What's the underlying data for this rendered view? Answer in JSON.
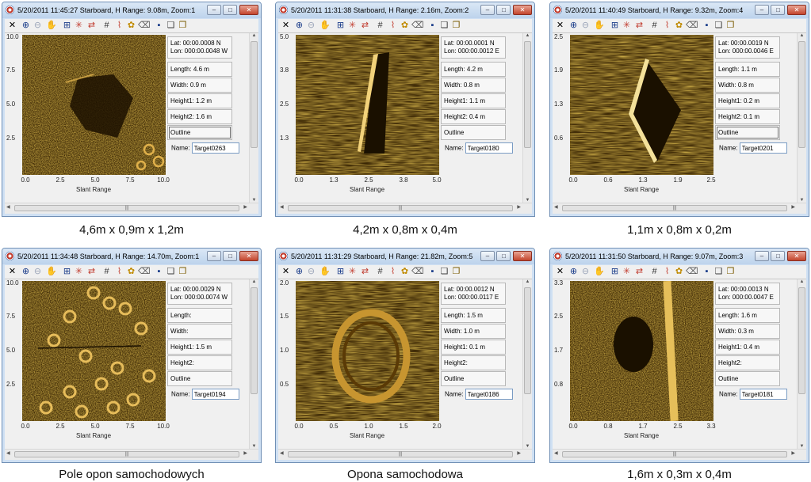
{
  "panels": [
    {
      "title": "5/20/2011 11:45:27 Starboard, H Range: 9.08m, Zoom:1",
      "y_ticks": [
        "10.0",
        "7.5",
        "5.0",
        "2.5"
      ],
      "x_ticks": [
        "0.0",
        "2.5",
        "5.0",
        "7.5",
        "10.0"
      ],
      "x_label": "Slant Range",
      "lat": "Lat:    00:00.0008 N",
      "lon": "Lon: 000:00.0048 W",
      "length": "Length:  4.6 m",
      "width": "Width:   0.9 m",
      "height1": "Height1:  1.2 m",
      "height2": "Height2:  1.6 m",
      "outline": "Outline",
      "name_label": "Name:",
      "name_value": "Target0263",
      "caption": "4,6m x 0,9m x 1,2m"
    },
    {
      "title": "5/20/2011 11:31:38 Starboard, H Range: 2.16m, Zoom:2",
      "y_ticks": [
        "5.0",
        "3.8",
        "2.5",
        "1.3"
      ],
      "x_ticks": [
        "0.0",
        "1.3",
        "2.5",
        "3.8",
        "5.0"
      ],
      "x_label": "Slant Range",
      "lat": "Lat:    00:00.0001 N",
      "lon": "Lon: 000:00.0012 E",
      "length": "Length:  4.2 m",
      "width": "Width:   0.8 m",
      "height1": "Height1:  1.1 m",
      "height2": "Height2:  0.4 m",
      "outline": "Outline",
      "name_label": "Name:",
      "name_value": "Target0180",
      "caption": "4,2m x 0,8m x 0,4m"
    },
    {
      "title": "5/20/2011 11:40:49 Starboard, H Range: 9.32m, Zoom:4",
      "y_ticks": [
        "2.5",
        "1.9",
        "1.3",
        "0.6"
      ],
      "x_ticks": [
        "0.0",
        "0.6",
        "1.3",
        "1.9",
        "2.5"
      ],
      "x_label": "Slant Range",
      "lat": "Lat:    00:00.0019 N",
      "lon": "Lon: 000:00.0046 E",
      "length": "Length:  1.1 m",
      "width": "Width:   0.8 m",
      "height1": "Height1:  0.2 m",
      "height2": "Height2:  0.1 m",
      "outline": "Outline",
      "name_label": "Name:",
      "name_value": "Target0201",
      "caption": "1,1m x 0,8m x 0,2m"
    },
    {
      "title": "5/20/2011 11:34:48 Starboard, H Range: 14.70m, Zoom:1",
      "y_ticks": [
        "10.0",
        "7.5",
        "5.0",
        "2.5"
      ],
      "x_ticks": [
        "0.0",
        "2.5",
        "5.0",
        "7.5",
        "10.0"
      ],
      "x_label": "Slant Range",
      "lat": "Lat:    00:00.0029 N",
      "lon": "Lon: 000:00.0074 W",
      "length": "Length:",
      "width": "Width:",
      "height1": "Height1:  1.5 m",
      "height2": "Height2:",
      "outline": "Outline",
      "name_label": "Name:",
      "name_value": "Target0194",
      "caption": "Pole opon samochodowych"
    },
    {
      "title": "5/20/2011 11:31:29 Starboard, H Range: 21.82m, Zoom:5",
      "y_ticks": [
        "2.0",
        "1.5",
        "1.0",
        "0.5"
      ],
      "x_ticks": [
        "0.0",
        "0.5",
        "1.0",
        "1.5",
        "2.0"
      ],
      "x_label": "Slant Range",
      "lat": "Lat:    00:00.0012 N",
      "lon": "Lon: 000:00.0117 E",
      "length": "Length:  1.5 m",
      "width": "Width:   1.0 m",
      "height1": "Height1:  0.1 m",
      "height2": "Height2:",
      "outline": "Outline",
      "name_label": "Name:",
      "name_value": "Target0186",
      "caption": "Opona samochodowa"
    },
    {
      "title": "5/20/2011 11:31:50 Starboard, H Range: 9.07m, Zoom:3",
      "y_ticks": [
        "3.3",
        "2.5",
        "1.7",
        "0.8"
      ],
      "x_ticks": [
        "0.0",
        "0.8",
        "1.7",
        "2.5",
        "3.3"
      ],
      "x_label": "Slant Range",
      "lat": "Lat:    00:00.0013 N",
      "lon": "Lon: 000:00.0047 E",
      "length": "Length:  1.6 m",
      "width": "Width:   0.3 m",
      "height1": "Height1:  0.4 m",
      "height2": "Height2:",
      "outline": "Outline",
      "name_label": "Name:",
      "name_value": "Target0181",
      "caption": "1,6m x 0,3m x 0,4m"
    }
  ],
  "window_buttons": {
    "minimize": "–",
    "maximize": "□",
    "close": "✕"
  },
  "toolbar_icons": [
    "close-x-icon",
    "zoom-in-icon",
    "zoom-out-icon",
    "pan-hand-icon",
    "grid-icon",
    "target-star-icon",
    "swap-arrows-icon",
    "hash-grid-icon",
    "chart-icon",
    "palette-icon",
    "eraser-icon",
    "save-icon",
    "layers-icon",
    "copy-icon"
  ]
}
